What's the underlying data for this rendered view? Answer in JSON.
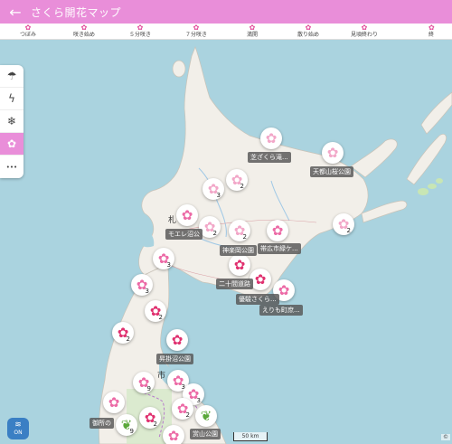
{
  "header": {
    "back_icon": "arrow-left-icon",
    "title": "さくら開花マップ"
  },
  "legend": [
    {
      "label": "つぼみ",
      "icon": "bud-icon"
    },
    {
      "label": "咲き始め",
      "icon": "blossom-start-icon"
    },
    {
      "label": "５分咲き",
      "icon": "half-bloom-icon"
    },
    {
      "label": "７分咲き",
      "icon": "seventy-bloom-icon"
    },
    {
      "label": "満開",
      "icon": "full-bloom-icon"
    },
    {
      "label": "散り始め",
      "icon": "falling-icon"
    },
    {
      "label": "見頃終わり",
      "icon": "end-icon"
    },
    {
      "label": "終",
      "icon": "end-icon"
    }
  ],
  "sidebar": [
    {
      "icon": "rain-cloud-icon",
      "glyph": "☂"
    },
    {
      "icon": "lightning-icon",
      "glyph": "ϟ"
    },
    {
      "icon": "snowflake-icon",
      "glyph": "❄"
    },
    {
      "icon": "sakura-icon",
      "glyph": "✿"
    },
    {
      "icon": "more-icon",
      "glyph": "•••"
    }
  ],
  "markers": [
    {
      "state": "bud",
      "count": ""
    },
    {
      "state": "bud",
      "count": ""
    },
    {
      "state": "bud",
      "count": "3"
    },
    {
      "state": "bud",
      "count": "2"
    },
    {
      "state": "half",
      "count": ""
    },
    {
      "state": "bud",
      "count": "2"
    },
    {
      "state": "bud",
      "count": "2"
    },
    {
      "state": "half",
      "count": ""
    },
    {
      "state": "bud",
      "count": "2"
    },
    {
      "state": "half",
      "count": "3"
    },
    {
      "state": "full",
      "count": ""
    },
    {
      "state": "half",
      "count": "3"
    },
    {
      "state": "full",
      "count": ""
    },
    {
      "state": "half",
      "count": ""
    },
    {
      "state": "full",
      "count": "2"
    },
    {
      "state": "full",
      "count": "2"
    },
    {
      "state": "full",
      "count": ""
    },
    {
      "state": "half",
      "count": "9"
    },
    {
      "state": "half",
      "count": "3"
    },
    {
      "state": "half",
      "count": "3"
    },
    {
      "state": "half",
      "count": ""
    },
    {
      "state": "full",
      "count": "2"
    },
    {
      "state": "half",
      "count": "2"
    },
    {
      "state": "green",
      "count": "9"
    },
    {
      "state": "green",
      "count": ""
    },
    {
      "state": "half",
      "count": ""
    }
  ],
  "labels": [
    "芝ざくら滝...",
    "天都山桜公園",
    "モエレ沼公",
    "神楽岡公園",
    "帯広市緑ケ...",
    "二十間道路",
    "優駿さくら...",
    "えりも町庶...",
    "昇掛沼公園",
    "御所の",
    "赏山公園"
  ],
  "map_text": {
    "city": "札",
    "city2": "市"
  },
  "scale_label": "50 km",
  "copyright": "©",
  "weather_toggle": {
    "icon": "weather-wave-icon",
    "label": "ON"
  },
  "colors": {
    "header": "#e98ed9",
    "sakura": "#e24d9b",
    "sea": "#aad3df",
    "land": "#f2efe9"
  }
}
